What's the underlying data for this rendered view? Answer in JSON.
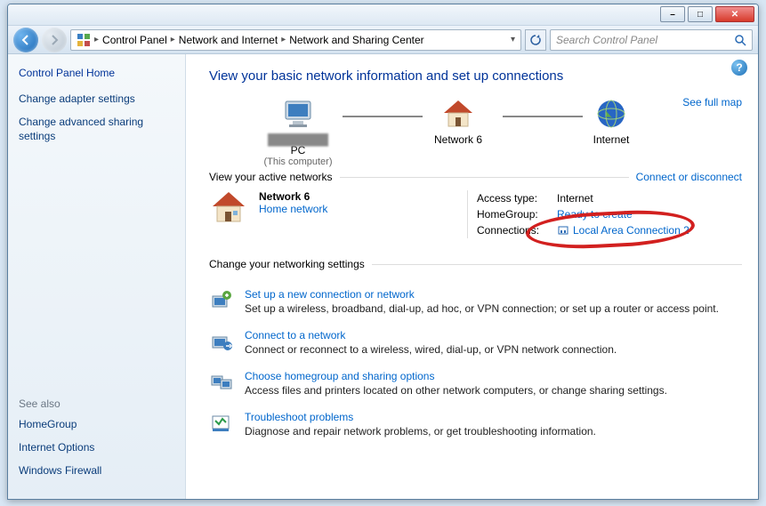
{
  "window_controls": {
    "minimize": "–",
    "maximize": "□",
    "close": "✕"
  },
  "breadcrumb": {
    "seg1": "Control Panel",
    "seg2": "Network and Internet",
    "seg3": "Network and Sharing Center"
  },
  "search": {
    "placeholder": "Search Control Panel"
  },
  "sidebar": {
    "home": "Control Panel Home",
    "links": [
      "Change adapter settings",
      "Change advanced sharing settings"
    ],
    "seealso_label": "See also",
    "seealso": [
      "HomeGroup",
      "Internet Options",
      "Windows Firewall"
    ]
  },
  "main": {
    "title": "View your basic network information and set up connections",
    "full_map": "See full map",
    "map": {
      "node1": "PC",
      "node1_sub": "(This computer)",
      "node2": "Network  6",
      "node3": "Internet"
    },
    "active_hdr": "View your active networks",
    "connect_link": "Connect or disconnect",
    "network": {
      "name": "Network  6",
      "type": "Home network",
      "access_label": "Access type:",
      "access_value": "Internet",
      "homegroup_label": "HomeGroup:",
      "homegroup_value": "Ready to create",
      "conn_label": "Connections:",
      "conn_value": "Local Area Connection 2"
    },
    "settings_hdr": "Change your networking settings",
    "settings": [
      {
        "title": "Set up a new connection or network",
        "desc": "Set up a wireless, broadband, dial-up, ad hoc, or VPN connection; or set up a router or access point."
      },
      {
        "title": "Connect to a network",
        "desc": "Connect or reconnect to a wireless, wired, dial-up, or VPN network connection."
      },
      {
        "title": "Choose homegroup and sharing options",
        "desc": "Access files and printers located on other network computers, or change sharing settings."
      },
      {
        "title": "Troubleshoot problems",
        "desc": "Diagnose and repair network problems, or get troubleshooting information."
      }
    ]
  }
}
